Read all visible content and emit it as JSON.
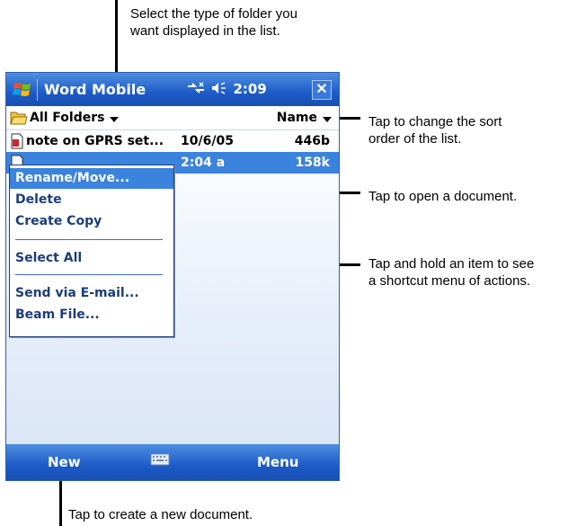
{
  "callouts": {
    "folder_type": [
      "Select the type of folder you",
      "want displayed in the list."
    ],
    "sort_order": [
      "Tap to change the sort",
      "order of the list."
    ],
    "open_doc": "Tap to open a document.",
    "shortcut_menu": [
      "Tap and hold an item to see",
      "a shortcut menu of actions."
    ],
    "new_doc": "Tap to create a new document."
  },
  "titlebar": {
    "app_title": "Word Mobile",
    "time": "2:09",
    "close_label": "✕",
    "icons": [
      "windows-start-icon",
      "connectivity-icon",
      "speaker-icon"
    ]
  },
  "toolbar": {
    "folder_label": "All Folders",
    "sort_label": "Name"
  },
  "files": [
    {
      "name": "note on GPRS set...",
      "date": "10/6/05",
      "size": "446b",
      "selected": false,
      "icon": "word-document-icon"
    },
    {
      "name": "",
      "date": "2:04 a",
      "size": "158k",
      "selected": true,
      "icon": "document-icon"
    }
  ],
  "context_menu": {
    "items": [
      "Rename/Move...",
      "Delete",
      "Create Copy",
      "Select All",
      "Send via E-mail...",
      "Beam File..."
    ],
    "highlighted": "Rename/Move..."
  },
  "bottombar": {
    "new_label": "New",
    "menu_label": "Menu",
    "keyboard_icon": "keyboard-icon"
  },
  "colors": {
    "bar_blue": "#1d5bc7",
    "selection_blue": "#3b83dc",
    "menu_text": "#1c3d7a"
  }
}
